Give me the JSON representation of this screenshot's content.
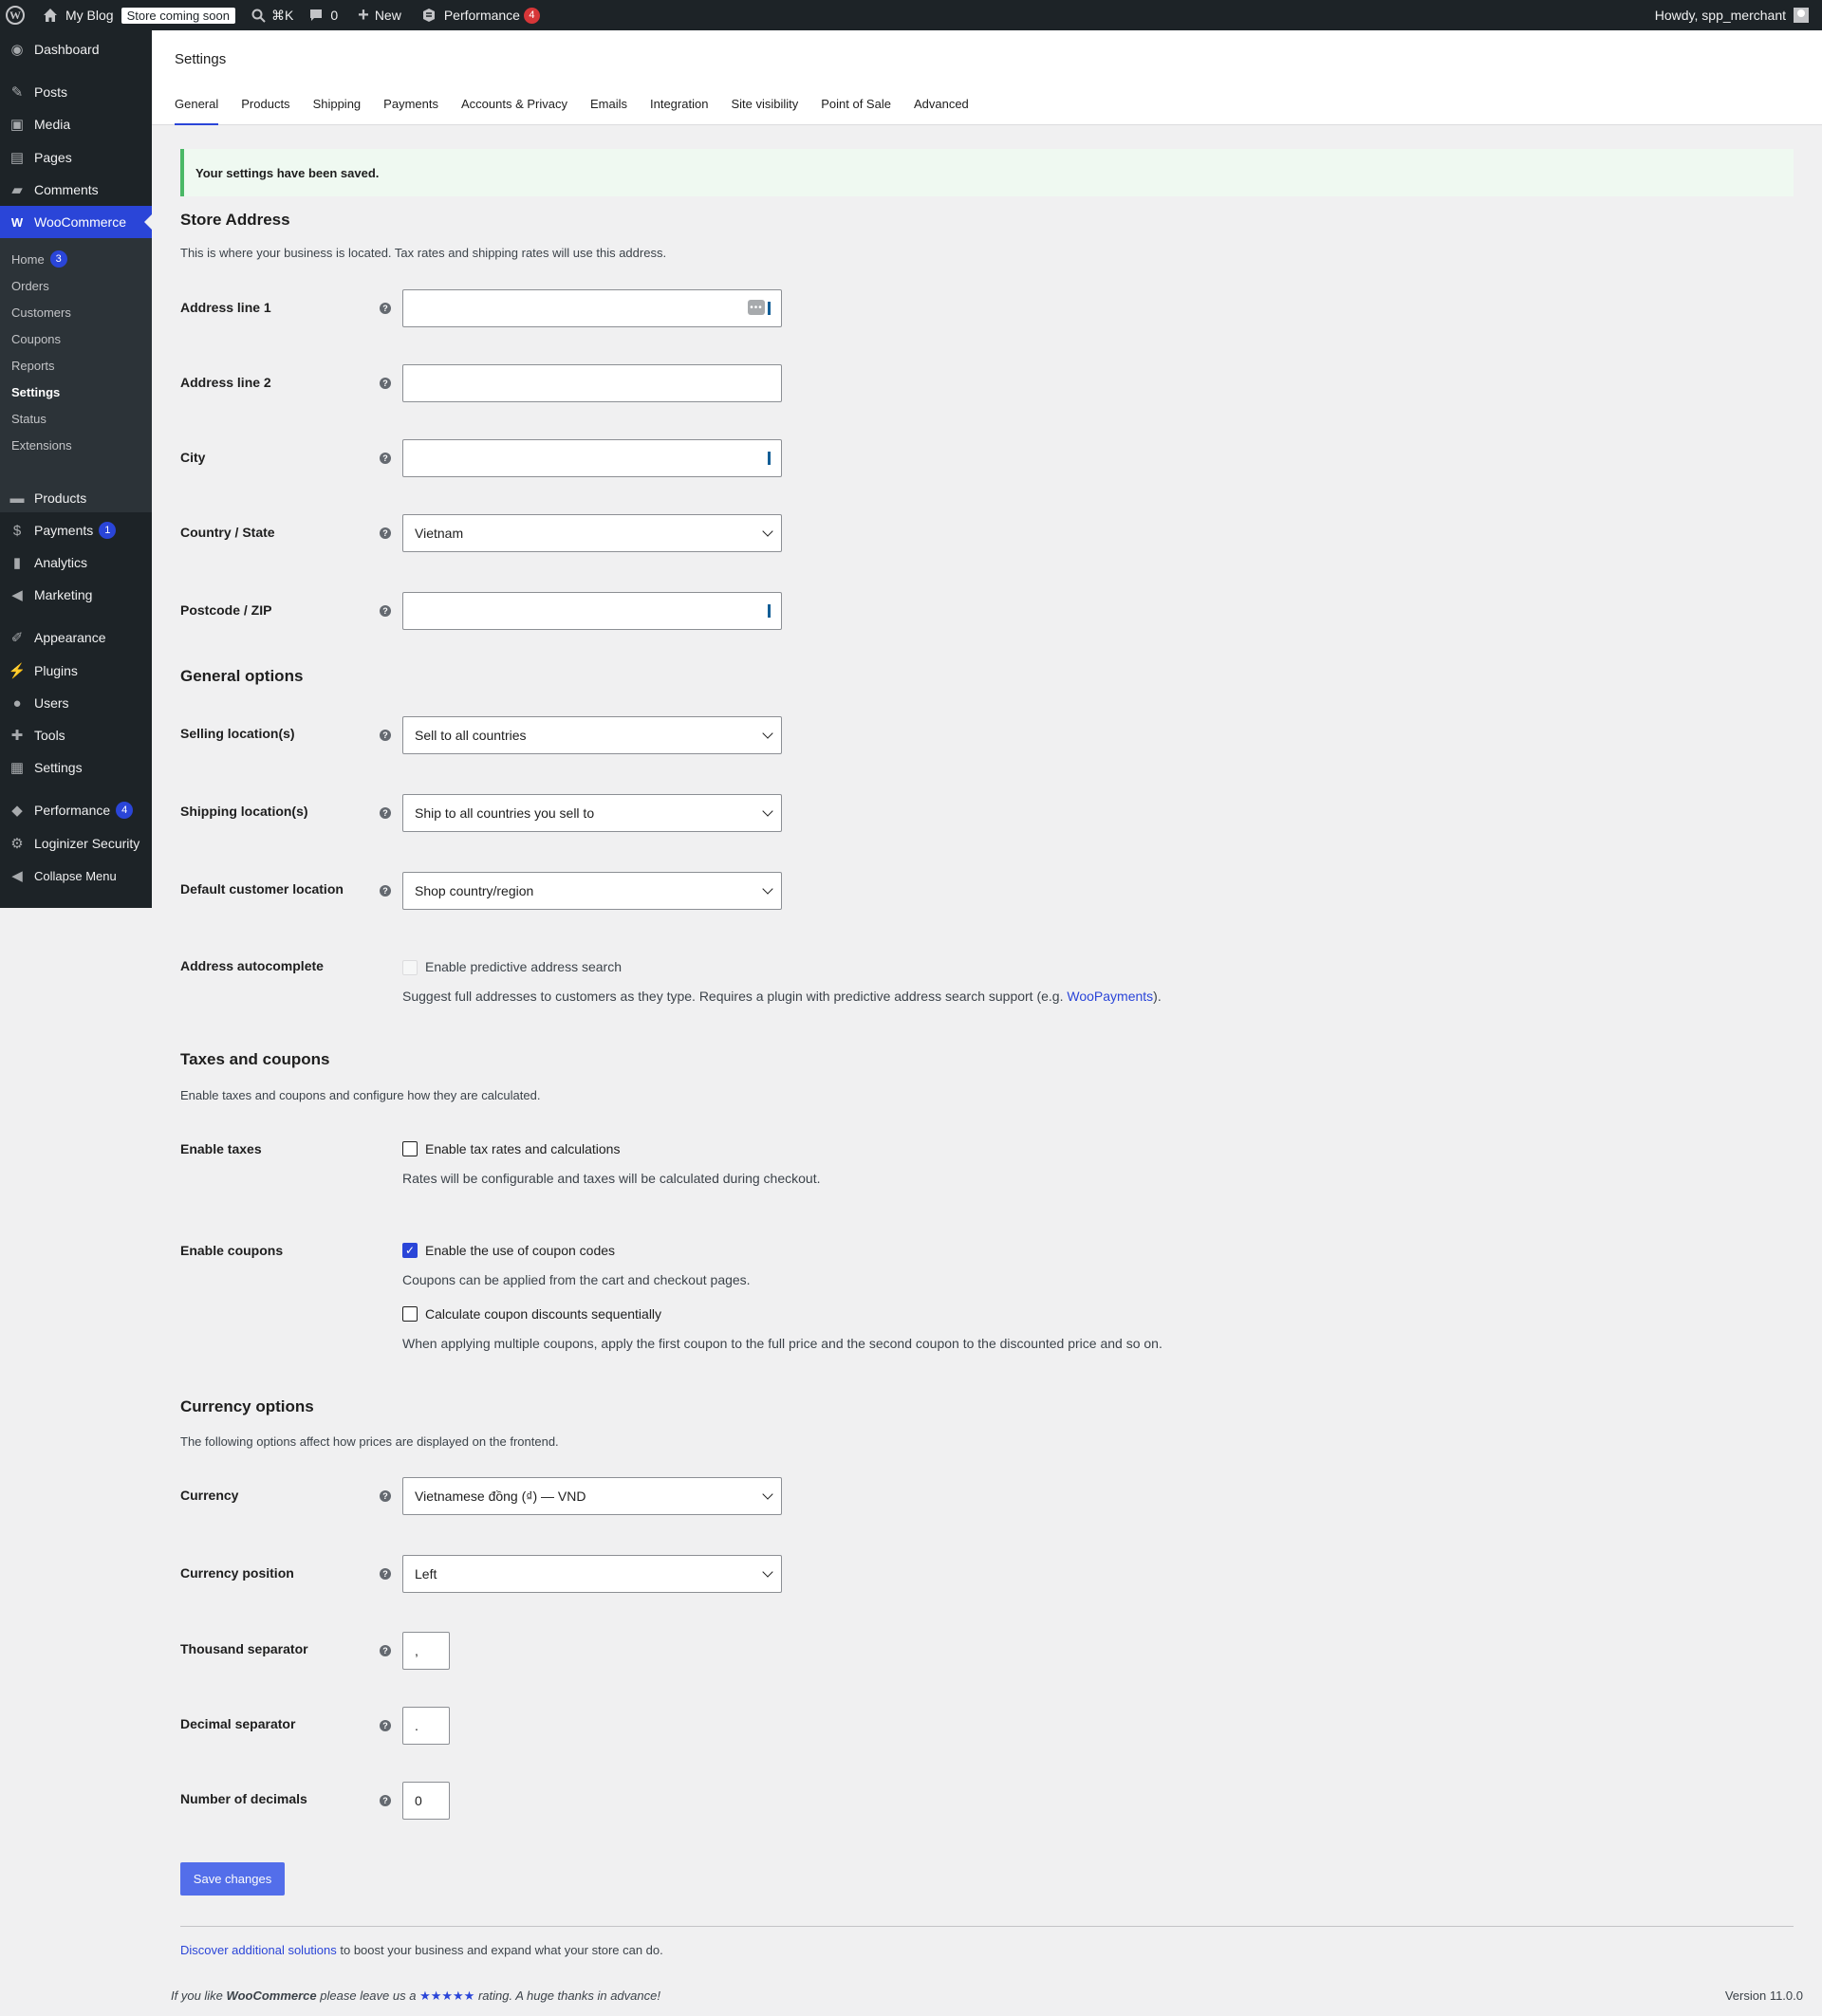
{
  "adminbar": {
    "site_name": "My Blog",
    "store_badge": "Store coming soon",
    "shortcut": "⌘K",
    "comments_count": "0",
    "new_label": "New",
    "performance_label": "Performance",
    "performance_count": "4",
    "howdy": "Howdy, spp_merchant"
  },
  "sidebar": {
    "dashboard": "Dashboard",
    "posts": "Posts",
    "media": "Media",
    "pages": "Pages",
    "comments": "Comments",
    "woocommerce": "WooCommerce",
    "woo_sub": {
      "home": "Home",
      "home_badge": "3",
      "orders": "Orders",
      "customers": "Customers",
      "coupons": "Coupons",
      "reports": "Reports",
      "settings": "Settings",
      "status": "Status",
      "extensions": "Extensions"
    },
    "products": "Products",
    "payments": "Payments",
    "payments_badge": "1",
    "analytics": "Analytics",
    "marketing": "Marketing",
    "appearance": "Appearance",
    "plugins": "Plugins",
    "users": "Users",
    "tools": "Tools",
    "settings": "Settings",
    "performance": "Performance",
    "performance_badge": "4",
    "loginizer": "Loginizer Security",
    "collapse": "Collapse Menu"
  },
  "header": {
    "title": "Settings",
    "tabs": [
      "General",
      "Products",
      "Shipping",
      "Payments",
      "Accounts & Privacy",
      "Emails",
      "Integration",
      "Site visibility",
      "Point of Sale",
      "Advanced"
    ]
  },
  "notice": "Your settings have been saved.",
  "store_address": {
    "heading": "Store Address",
    "description": "This is where your business is located. Tax rates and shipping rates will use this address.",
    "address1_label": "Address line 1",
    "address1_value": "",
    "address2_label": "Address line 2",
    "address2_value": "",
    "city_label": "City",
    "city_value": "",
    "country_label": "Country / State",
    "country_value": "Vietnam",
    "postcode_label": "Postcode / ZIP",
    "postcode_value": ""
  },
  "general_options": {
    "heading": "General options",
    "selling_label": "Selling location(s)",
    "selling_value": "Sell to all countries",
    "shipping_label": "Shipping location(s)",
    "shipping_value": "Ship to all countries you sell to",
    "default_loc_label": "Default customer location",
    "default_loc_value": "Shop country/region",
    "autocomplete_label": "Address autocomplete",
    "autocomplete_cb_label": "Enable predictive address search",
    "autocomplete_checked": false,
    "autocomplete_hint_prefix": "Suggest full addresses to customers as they type. Requires a plugin with predictive address search support (e.g. ",
    "autocomplete_hint_link": "WooPayments",
    "autocomplete_hint_suffix": ")."
  },
  "taxes": {
    "heading": "Taxes and coupons",
    "description": "Enable taxes and coupons and configure how they are calculated.",
    "enable_taxes_label": "Enable taxes",
    "taxes_cb_label": "Enable tax rates and calculations",
    "taxes_checked": false,
    "taxes_hint": "Rates will be configurable and taxes will be calculated during checkout.",
    "enable_coupons_label": "Enable coupons",
    "coupons_cb_label": "Enable the use of coupon codes",
    "coupons_checked": true,
    "coupons_hint": "Coupons can be applied from the cart and checkout pages.",
    "sequential_cb_label": "Calculate coupon discounts sequentially",
    "sequential_checked": false,
    "sequential_hint": "When applying multiple coupons, apply the first coupon to the full price and the second coupon to the discounted price and so on."
  },
  "currency": {
    "heading": "Currency options",
    "description": "The following options affect how prices are displayed on the frontend.",
    "currency_label": "Currency",
    "currency_value": "Vietnamese đồng (₫) — VND",
    "position_label": "Currency position",
    "position_value": "Left",
    "thousand_label": "Thousand separator",
    "thousand_value": ",",
    "decimal_label": "Decimal separator",
    "decimal_value": ".",
    "decimals_label": "Number of decimals",
    "decimals_value": "0"
  },
  "save_button": "Save changes",
  "discover": {
    "link": "Discover additional solutions",
    "text": " to boost your business and expand what your store can do."
  },
  "footer": {
    "prefix": "If you like ",
    "brand": "WooCommerce",
    "middle": " please leave us a ",
    "stars": "★★★★★",
    "suffix": " rating. A huge thanks in advance!",
    "version": "Version 11.0.0"
  }
}
